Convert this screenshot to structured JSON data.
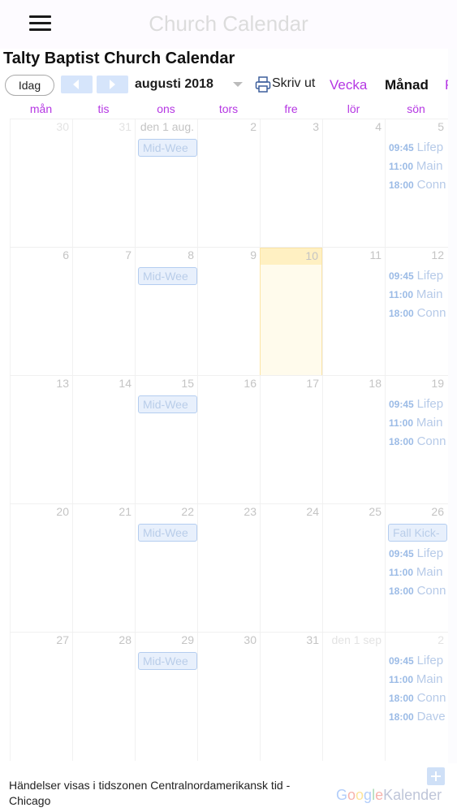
{
  "app": {
    "title": "Church Calendar"
  },
  "calendar": {
    "title": "Talty Baptist Church Calendar"
  },
  "toolbar": {
    "today_label": "Idag",
    "month_label": "augusti 2018",
    "print_label": "Skriv ut",
    "tabs": {
      "week": "Vecka",
      "month": "Månad",
      "agenda": "Pr"
    }
  },
  "weekdays": [
    "mån",
    "tis",
    "ons",
    "tors",
    "fre",
    "lör",
    "sön"
  ],
  "weeks": [
    {
      "days": [
        "30",
        "31",
        "den 1 aug.",
        "2",
        "3",
        "4",
        "5"
      ]
    },
    {
      "days": [
        "6",
        "7",
        "8",
        "9",
        "10",
        "11",
        "12"
      ]
    },
    {
      "days": [
        "13",
        "14",
        "15",
        "16",
        "17",
        "18",
        "19"
      ]
    },
    {
      "days": [
        "20",
        "21",
        "22",
        "23",
        "24",
        "25",
        "26"
      ]
    },
    {
      "days": [
        "27",
        "28",
        "29",
        "30",
        "31",
        "den 1 sep",
        "2"
      ]
    }
  ],
  "events": {
    "midweek": "Mid-Wee",
    "fall_kickoff": "Fall Kick-",
    "lifep": {
      "time": "09:45",
      "name": "Lifep"
    },
    "main": {
      "time": "11:00",
      "name": "Main"
    },
    "conn": {
      "time": "18:00",
      "name": "Conn"
    },
    "dave": {
      "time": "18:00",
      "name": "Dave"
    }
  },
  "footer": {
    "timezone": "Händelser visas i tidszonen Centralnordamerikansk tid - Chicago",
    "logo_google": "Google",
    "logo_calendar": "Kalender"
  },
  "colors": {
    "accent": "#b537e3",
    "event_chip_bg": "#e8f0fc",
    "today_bg": "#fffbec",
    "event_time": "#9bbbe6"
  }
}
